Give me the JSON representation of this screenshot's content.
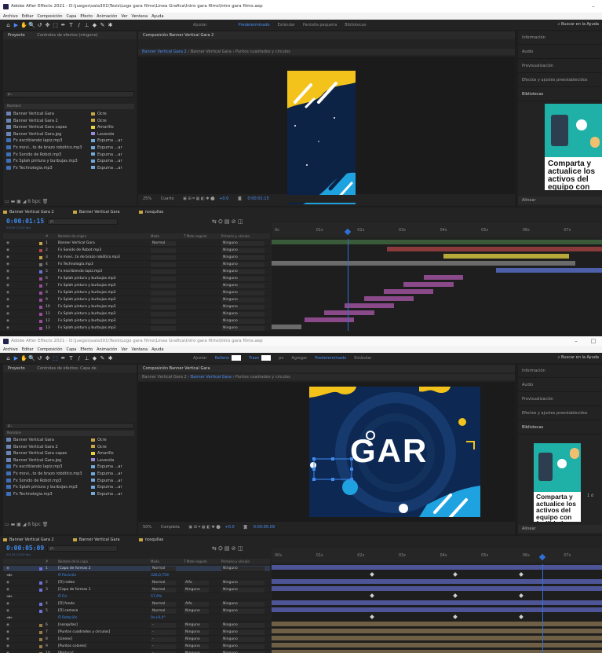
{
  "window": {
    "title_1": "Adobe After Effects 2021 - D:\\juegos\\sala301\\Tesis\\Logo gara films\\Linea Grafica\\Intro gara films\\Intro gara films.aep",
    "title_2": "Adobe After Effects 2021 - D:\\juegos\\sala301\\Tesis\\Logo gara films\\Linea Grafica\\Intro gara films\\Intro gara films.aep",
    "minimize": "–",
    "restore": "□"
  },
  "menu": [
    "Archivo",
    "Editar",
    "Composición",
    "Capa",
    "Efecto",
    "Animación",
    "Ver",
    "Ventana",
    "Ayuda"
  ],
  "toolbar": {
    "tools": [
      "⌂",
      "▶",
      "✋",
      "🔍",
      "↺",
      "✥",
      "⬚",
      "✒",
      "T",
      "/",
      "⊥",
      "◆",
      "✎",
      "✱"
    ],
    "align": "Ajustar",
    "workspaces_1": [
      "Predeterminado",
      "Estándar",
      "Pantalla pequeña",
      "Bibliotecas"
    ],
    "workspaces_2": [
      "Relleno",
      "Trazo",
      "px",
      "Agregar",
      "Predeterminado",
      "Estándar"
    ],
    "search_help": "Buscar en la Ayuda"
  },
  "project_panel": {
    "tab_project": "Proyecto",
    "tab_effects_1": "Controles de efectos (ninguno)",
    "tab_effects_2": "Controles de efectos: Capa de",
    "search_placeholder": "ρ₊",
    "col_name": "Nombre",
    "col_label": "",
    "items_1": [
      {
        "name": "Banner Vertical Gara",
        "label": "Ocre",
        "color": "#c9a644",
        "kind": "comp"
      },
      {
        "name": "Banner Vertical Gara 2",
        "label": "Ocre",
        "color": "#c9a644",
        "kind": "comp"
      },
      {
        "name": "Banner Vertical Gara capas",
        "label": "Amarillo",
        "color": "#e3d33c",
        "kind": "folder"
      },
      {
        "name": "Banner Vertical Gara.jpg",
        "label": "Lavanda",
        "color": "#9b8ad6",
        "kind": "img"
      },
      {
        "name": "Fx escribiendo lapiz.mp3",
        "label": "Espuma ...ar",
        "color": "#6fa8d9",
        "kind": "audio"
      },
      {
        "name": "Fx movi...to de brazo robótico.mp3",
        "label": "Espuma ...ar",
        "color": "#6fa8d9",
        "kind": "audio"
      },
      {
        "name": "Fx Sonido de Robot.mp3",
        "label": "Espuma ...ar",
        "color": "#6fa8d9",
        "kind": "audio"
      },
      {
        "name": "Fx Splah pintura y burbujas.mp3",
        "label": "Espuma ...ar",
        "color": "#6fa8d9",
        "kind": "audio"
      },
      {
        "name": "Fx Technologia.mp3",
        "label": "Espuma ...ar",
        "color": "#6fa8d9",
        "kind": "audio"
      }
    ],
    "items_2": [
      {
        "name": "Banner Vertical Gara",
        "label": "Ocre",
        "color": "#c9a644",
        "kind": "comp"
      },
      {
        "name": "Banner Vertical Gara 2",
        "label": "Ocre",
        "color": "#c9a644",
        "kind": "comp"
      },
      {
        "name": "Banner Vertical Gara capas",
        "label": "Amarillo",
        "color": "#e3d33c",
        "kind": "folder"
      },
      {
        "name": "Banner Vertical Gara.jpg",
        "label": "Lavanda",
        "color": "#9b8ad6",
        "kind": "img"
      },
      {
        "name": "Fx escribiendo lapiz.mp3",
        "label": "Espuma ...ar",
        "color": "#6fa8d9",
        "kind": "audio"
      },
      {
        "name": "Fx movi...to de brazo robótico.mp3",
        "label": "Espuma ...ar",
        "color": "#6fa8d9",
        "kind": "audio"
      },
      {
        "name": "Fx Sonido de Robot.mp3",
        "label": "Espuma ...ar",
        "color": "#6fa8d9",
        "kind": "audio"
      },
      {
        "name": "Fx Splah pintura y burbujas.mp3",
        "label": "Espuma ...ar",
        "color": "#6fa8d9",
        "kind": "audio"
      },
      {
        "name": "Fx Technologia.mp3",
        "label": "Espuma ...ar",
        "color": "#6fa8d9",
        "kind": "audio"
      }
    ],
    "bottom_1": "▭ ▬ ▣ ◢  8 bpc  🗑",
    "bottom_2": "▭ ▬ ▣ ◢  8 bpc  🗑"
  },
  "comp_panel": {
    "header_1": "Composición Banner Vertical Gara 2",
    "header_2": "Composición Banner Vertical Gara",
    "crumbs_1": [
      "Banner Vertical Gara 2",
      "Banner Vertical Gara",
      "Puntos cuadrados y circulos"
    ],
    "crumbs_2": [
      "Banner Vertical Gara 2",
      "Banner Vertical Gara",
      "Puntos cuadrados y circulos"
    ],
    "zoom_1": "25%",
    "quality_1": "Cuarto",
    "time_1": "0:00:01:15",
    "zoom_2": "50%",
    "quality_2": "Completa",
    "time_2": "0:00:05:09",
    "exposure": "+0.0",
    "logo_text": "GAR"
  },
  "right_panel": {
    "items": [
      "Información",
      "Audio",
      "Previsualización",
      "Efectos y ajustes preestablecidos",
      "Bibliotecas"
    ],
    "lib_text": "Comparta y actualice los activos del equipo con facilidad",
    "lib_side": "1 d",
    "align": "Alinear"
  },
  "timeline_1": {
    "tabs": [
      {
        "name": "Banner Vertical Gara 2",
        "color": "#c9a644"
      },
      {
        "name": "Banner Vertical Gara",
        "color": "#c9a644"
      },
      {
        "name": "nosqullas",
        "color": "#c9a644"
      }
    ],
    "timecode": "0:00:01:15",
    "frames": "00039 (25.00 fps)",
    "search": "ρ₊",
    "cols": [
      "#",
      "Nombre de origen",
      "Modo",
      "T  Mate seguim.",
      "Primario y vínculo"
    ],
    "ruler": [
      "0s",
      "01s",
      "02s",
      "03s",
      "04s",
      "05s",
      "06s",
      "07s"
    ],
    "layers": [
      {
        "num": "1",
        "name": "Banner Vertical Gara",
        "mode": "Normal",
        "parent": "Ninguno",
        "color": "#c9a644",
        "bar": [
          0,
          100
        ],
        "barcolor": "#3a5a3a"
      },
      {
        "num": "2",
        "name": "Fx Sonido de Robot.mp3",
        "mode": "",
        "parent": "Ninguno",
        "color": "#b04646",
        "bar": [
          35,
          100
        ],
        "barcolor": "#8a3a3a"
      },
      {
        "num": "3",
        "name": "Fx movi...to de brazo robótico.mp3",
        "mode": "",
        "parent": "Ninguno",
        "color": "#c9a644",
        "bar": [
          52,
          90
        ],
        "barcolor": "#b8a83a"
      },
      {
        "num": "4",
        "name": "Fx Technologia.mp3",
        "mode": "",
        "parent": "Ninguno",
        "color": "#777",
        "bar": [
          0,
          92
        ],
        "barcolor": "#6b6b6b"
      },
      {
        "num": "5",
        "name": "Fx escribiendo lapiz.mp3",
        "mode": "",
        "parent": "Ninguno",
        "color": "#6f72d8",
        "bar": [
          68,
          100
        ],
        "barcolor": "#4d5fa8"
      },
      {
        "num": "6",
        "name": "Fx Splah pintura y burbujas.mp3",
        "mode": "",
        "parent": "Ninguno",
        "color": "#9a4d9a",
        "bar": [
          46,
          58
        ],
        "barcolor": "#8a4a8a"
      },
      {
        "num": "7",
        "name": "Fx Splah pintura y burbujas.mp3",
        "mode": "",
        "parent": "Ninguno",
        "color": "#9a4d9a",
        "bar": [
          40,
          55
        ],
        "barcolor": "#8a4a8a"
      },
      {
        "num": "8",
        "name": "Fx Splah pintura y burbujas.mp3",
        "mode": "",
        "parent": "Ninguno",
        "color": "#9a4d9a",
        "bar": [
          34,
          49
        ],
        "barcolor": "#8a4a8a"
      },
      {
        "num": "9",
        "name": "Fx Splah pintura y burbujas.mp3",
        "mode": "",
        "parent": "Ninguno",
        "color": "#9a4d9a",
        "bar": [
          28,
          43
        ],
        "barcolor": "#8a4a8a"
      },
      {
        "num": "10",
        "name": "Fx Splah pintura y burbujas.mp3",
        "mode": "",
        "parent": "Ninguno",
        "color": "#9a4d9a",
        "bar": [
          22,
          37
        ],
        "barcolor": "#8a4a8a"
      },
      {
        "num": "11",
        "name": "Fx Splah pintura y burbujas.mp3",
        "mode": "",
        "parent": "Ninguno",
        "color": "#9a4d9a",
        "bar": [
          16,
          31
        ],
        "barcolor": "#8a4a8a"
      },
      {
        "num": "12",
        "name": "Fx Splah pintura y burbujas.mp3",
        "mode": "",
        "parent": "Ninguno",
        "color": "#9a4d9a",
        "bar": [
          10,
          25
        ],
        "barcolor": "#8a4a8a"
      },
      {
        "num": "13",
        "name": "Fx Splah pintura y burbujas.mp3",
        "mode": "",
        "parent": "Ninguno",
        "color": "#9a4d9a",
        "bar": [
          0,
          9
        ],
        "barcolor": "#6b6b6b"
      }
    ],
    "playhead": 0.23
  },
  "timeline_2": {
    "tabs": [
      {
        "name": "Banner Vertical Gara 2",
        "color": "#c9a644"
      },
      {
        "name": "Banner Vertical Gara",
        "color": "#c9a644"
      },
      {
        "name": "nosqullas",
        "color": "#c9a644"
      }
    ],
    "timecode": "0:00:05:09",
    "frames": "00134 (25.00 fps)",
    "search": "ρ₊",
    "cols": [
      "#",
      "Nombre de la capa",
      "Modo",
      "T  Mate seguim.",
      "Primario y vínculo"
    ],
    "ruler": [
      "00s",
      "01s",
      "02s",
      "03s",
      "04s",
      "05s",
      "06s",
      "07s"
    ],
    "layers": [
      {
        "num": "1",
        "name": "[Capa de formas 2",
        "mode": "Normal",
        "track": "",
        "parent": "Ninguno",
        "color": "#6f72d8",
        "type": "layer",
        "sel": true
      },
      {
        "num": "",
        "name": "Ö Posición",
        "mode": "",
        "track": "",
        "parent": "",
        "value": "326,0,759",
        "type": "prop"
      },
      {
        "num": "2",
        "name": "[Ü] rodeo",
        "mode": "Normal",
        "track": "Alfa",
        "parent": "Ninguno",
        "color": "#6f72d8",
        "type": "layer"
      },
      {
        "num": "3",
        "name": "[Capa de formas 1",
        "mode": "Normal",
        "track": "Ninguno",
        "parent": "Ninguno",
        "color": "#6f72d8",
        "type": "layer"
      },
      {
        "num": "",
        "name": "Ö Fin",
        "mode": "",
        "track": "",
        "parent": "",
        "value": "57,9%",
        "type": "prop"
      },
      {
        "num": "4",
        "name": "[Ü] fondo",
        "mode": "Normal",
        "track": "Alfa",
        "parent": "Ninguno",
        "color": "#6f72d8",
        "type": "layer"
      },
      {
        "num": "5",
        "name": "[Ü] camara",
        "mode": "Normal",
        "track": "Ninguno",
        "parent": "Ninguno",
        "color": "#6f72d8",
        "type": "layer"
      },
      {
        "num": "",
        "name": "Ö Rotación",
        "mode": "",
        "track": "",
        "parent": "",
        "value": "0x+0,0°",
        "type": "prop"
      },
      {
        "num": "6",
        "name": "[nosqullas]",
        "mode": "-",
        "track": "Ninguno",
        "parent": "Ninguno",
        "color": "#9a7a4a",
        "type": "layer"
      },
      {
        "num": "7",
        "name": "[Puntos cuadrados y circulos]",
        "mode": "-",
        "track": "Ninguno",
        "parent": "Ninguno",
        "color": "#9a7a4a",
        "type": "layer"
      },
      {
        "num": "8",
        "name": "[Lineas]",
        "mode": "-",
        "track": "Ninguno",
        "parent": "Ninguno",
        "color": "#9a7a4a",
        "type": "layer"
      },
      {
        "num": "9",
        "name": "[Puntos colores]",
        "mode": "-",
        "track": "Ninguno",
        "parent": "Ninguno",
        "color": "#9a7a4a",
        "type": "layer"
      },
      {
        "num": "10",
        "name": "[Pintura]",
        "mode": "-",
        "track": "Ninguno",
        "parent": "Ninguno",
        "color": "#9a7a4a",
        "type": "layer"
      }
    ],
    "playhead": 0.82
  }
}
